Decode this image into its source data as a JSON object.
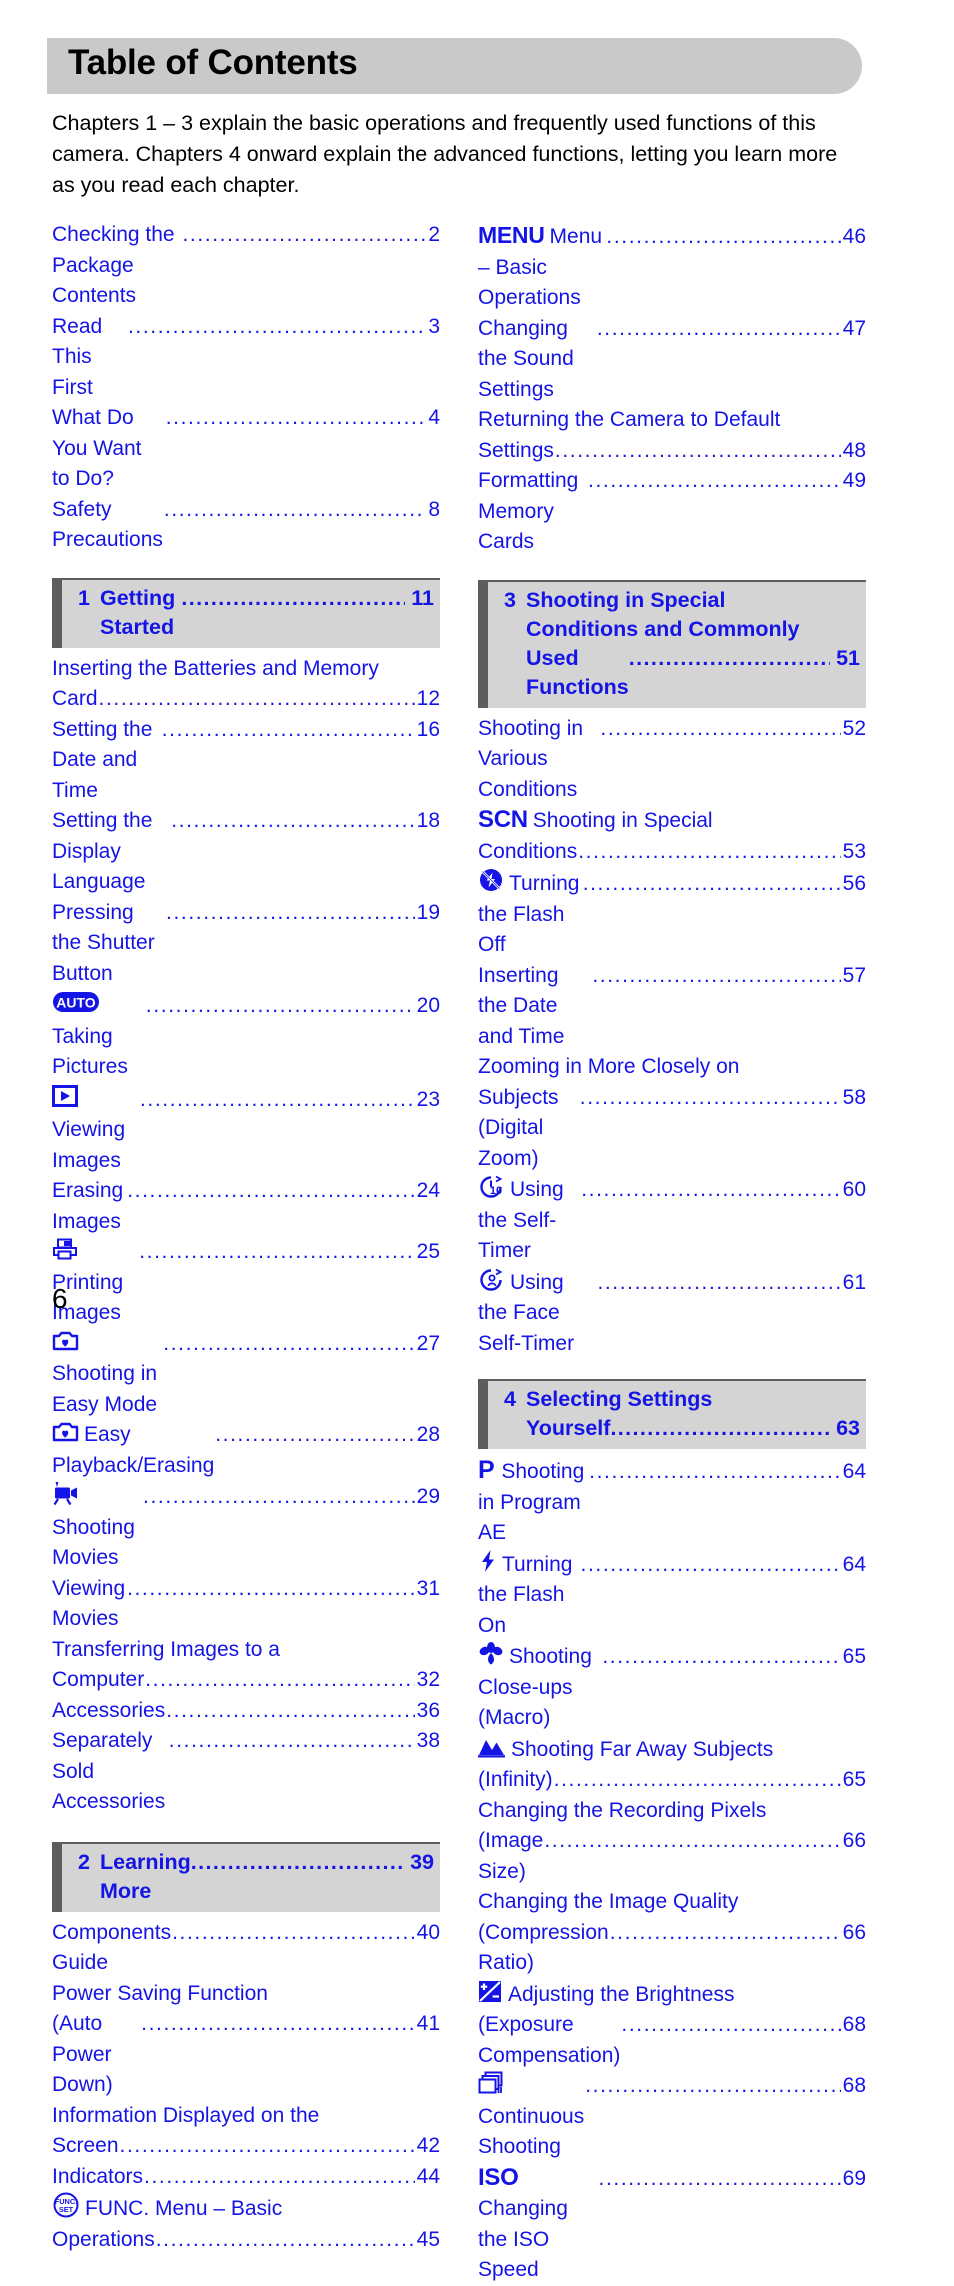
{
  "document": {
    "title": "Table of Contents",
    "page_number": "6",
    "intro": "Chapters 1 – 3 explain the basic operations and frequently used functions of this camera. Chapters 4 onward explain the advanced functions, letting you learn more as you read each chapter.",
    "colors": {
      "link_blue": "#1414e6",
      "banner_gray": "#c9c9c9",
      "chapter_bg_gray": "#d4d4d4",
      "chapter_bar_gray": "#5d5d5d",
      "text_black": "#000000"
    }
  },
  "left_column": {
    "front_matter": [
      {
        "icon": null,
        "label": "Checking the Package Contents",
        "page": "2"
      },
      {
        "icon": null,
        "label": "Read This First",
        "page": "3"
      },
      {
        "icon": null,
        "label": "What Do You Want to Do?",
        "page": "4"
      },
      {
        "icon": null,
        "label": "Safety Precautions",
        "page": "8"
      }
    ],
    "chapter1": {
      "number": "1",
      "title": "Getting Started",
      "page": "11",
      "entries": [
        {
          "icon": null,
          "label": "Inserting the Batteries and Memory",
          "label2": "Card",
          "page": "12"
        },
        {
          "icon": null,
          "label": "Setting the Date and Time",
          "page": "16"
        },
        {
          "icon": null,
          "label": "Setting the Display Language",
          "page": "18"
        },
        {
          "icon": null,
          "label": "Pressing the Shutter Button",
          "page": "19"
        },
        {
          "icon": "auto-mode-icon",
          "label": "Taking Pictures",
          "page": "20"
        },
        {
          "icon": "playback-icon",
          "label": "Viewing Images",
          "page": "23"
        },
        {
          "icon": null,
          "label": "Erasing Images",
          "page": "24"
        },
        {
          "icon": "printer-icon",
          "label": "Printing Images",
          "page": "25"
        },
        {
          "icon": "easy-mode-icon",
          "label": "Shooting in Easy Mode",
          "page": "27"
        },
        {
          "icon": "easy-mode-icon",
          "label": "Easy Playback/Erasing",
          "page": "28"
        },
        {
          "icon": "movie-camera-icon",
          "label": "Shooting Movies",
          "page": "29"
        },
        {
          "icon": null,
          "label": "Viewing Movies",
          "page": "31"
        },
        {
          "icon": null,
          "label": "Transferring Images to a",
          "label2": "Computer",
          "page": "32"
        },
        {
          "icon": null,
          "label": "Accessories",
          "page": "36"
        },
        {
          "icon": null,
          "label": "Separately Sold Accessories",
          "page": "38"
        }
      ]
    },
    "chapter2": {
      "number": "2",
      "title": "Learning More",
      "page": "39",
      "entries": [
        {
          "icon": null,
          "label": "Components Guide",
          "page": "40"
        },
        {
          "icon": null,
          "label": "Power Saving Function",
          "label2": "(Auto Power Down)",
          "page": "41"
        },
        {
          "icon": null,
          "label": "Information Displayed on the",
          "label2": "Screen",
          "page": "42"
        },
        {
          "icon": null,
          "label": "Indicators",
          "page": "44"
        },
        {
          "icon": "func-set-icon",
          "label": "FUNC. Menu – Basic",
          "label2": "Operations",
          "page": "45"
        }
      ]
    }
  },
  "right_column": {
    "chapter2_continued": [
      {
        "icon": "menu-text-icon",
        "icon_text": "MENU",
        "label": "Menu – Basic Operations",
        "page": "46"
      },
      {
        "icon": null,
        "label": "Changing the Sound Settings",
        "page": "47"
      },
      {
        "icon": null,
        "label": "Returning the Camera to Default",
        "label2": "Settings",
        "page": "48"
      },
      {
        "icon": null,
        "label": "Formatting Memory Cards",
        "page": "49"
      }
    ],
    "chapter3": {
      "number": "3",
      "title_line1": "Shooting in Special",
      "title_line2": "Conditions and Commonly",
      "title_line3": "Used Functions",
      "page": "51",
      "entries": [
        {
          "icon": null,
          "label": "Shooting in Various Conditions",
          "page": "52"
        },
        {
          "icon": "scn-text-icon",
          "icon_text": "SCN",
          "label": "Shooting in Special",
          "label2": "Conditions",
          "page": "53"
        },
        {
          "icon": "flash-off-icon",
          "label": "Turning the Flash Off",
          "page": "56"
        },
        {
          "icon": null,
          "label": "Inserting the Date and Time",
          "page": "57"
        },
        {
          "icon": null,
          "label": "Zooming in More Closely on",
          "label2": "Subjects (Digital Zoom)",
          "page": "58"
        },
        {
          "icon": "self-timer-icon",
          "label": "Using the Self-Timer",
          "page": "60"
        },
        {
          "icon": "face-self-timer-icon",
          "label": "Using the Face Self-Timer",
          "page": "61"
        }
      ]
    },
    "chapter4": {
      "number": "4",
      "title_line1": "Selecting Settings",
      "title_line2": "Yourself",
      "page": "63",
      "entries": [
        {
          "icon": "program-ae-icon",
          "icon_text": "P",
          "label": "Shooting in Program AE",
          "page": "64"
        },
        {
          "icon": "flash-on-icon",
          "label": "Turning the Flash On",
          "page": "64"
        },
        {
          "icon": "macro-icon",
          "label": "Shooting Close-ups (Macro)",
          "page": "65"
        },
        {
          "icon": "infinity-icon",
          "label": "Shooting Far Away Subjects",
          "label2": "(Infinity)",
          "page": "65"
        },
        {
          "icon": null,
          "label": "Changing the Recording Pixels",
          "label2": "(Image Size)",
          "page": "66"
        },
        {
          "icon": null,
          "label": "Changing the Image Quality",
          "label2": "(Compression Ratio)",
          "page": "66"
        },
        {
          "icon": "exposure-comp-icon",
          "label": "Adjusting the Brightness",
          "label2": "(Exposure Compensation)",
          "page": "68"
        },
        {
          "icon": "continuous-shooting-icon",
          "label": "Continuous Shooting",
          "page": "68"
        },
        {
          "icon": "iso-text-icon",
          "icon_text": "ISO",
          "label": "Changing the ISO Speed",
          "page": "69"
        }
      ]
    }
  }
}
